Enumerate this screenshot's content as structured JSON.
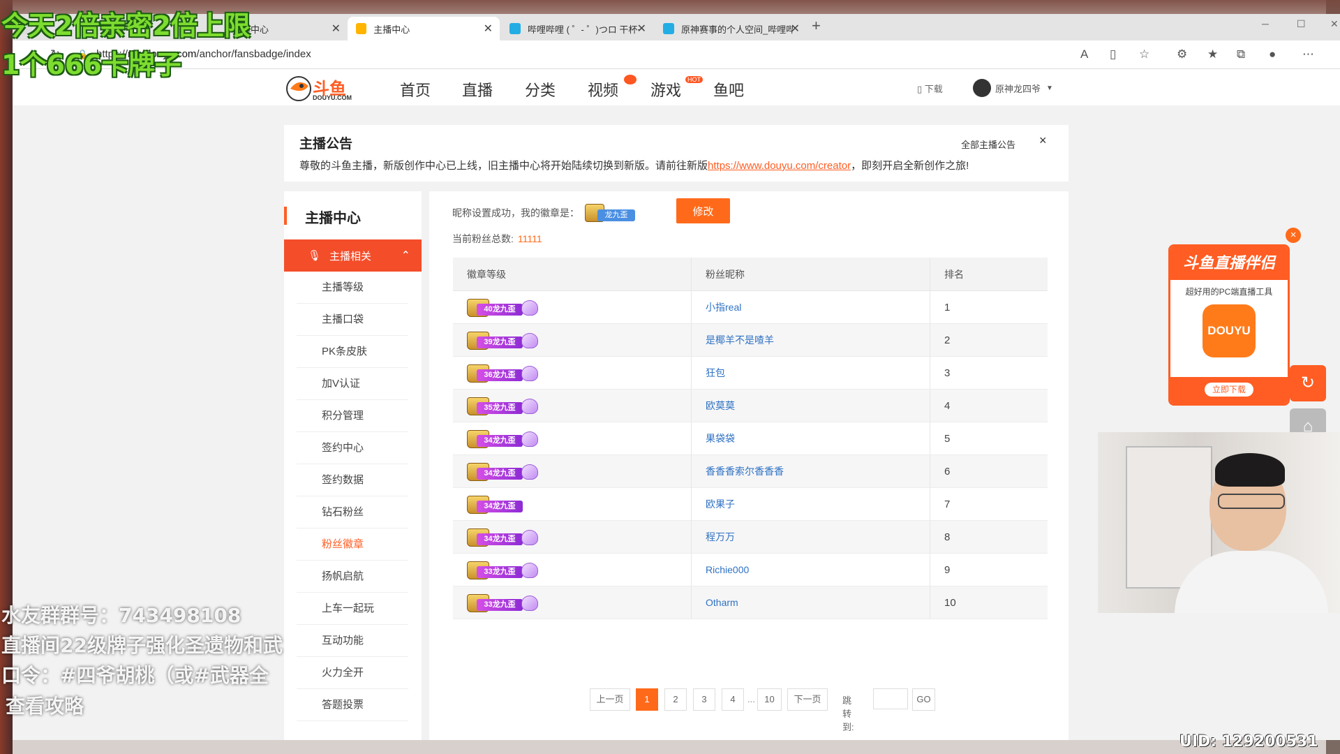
{
  "browser": {
    "tabs": [
      {
        "title": "作中心",
        "favicon_color": "#e8e8e8"
      },
      {
        "title": "主播中心",
        "favicon_color": "#ffb400"
      },
      {
        "title": "哔哩哔哩 ( ゜- ゜)つロ 干杯~-bilib",
        "favicon_color": "#23ade5"
      },
      {
        "title": "原神赛事的个人空间_哔哩哔哩_b",
        "favicon_color": "#23ade5"
      }
    ],
    "url_prefix": "https://",
    "url_host": "mp.douyu.com",
    "url_path": "/anchor/fansbadge/index"
  },
  "header": {
    "logo_text": "斗鱼",
    "logo_sub": "DOUYU.COM",
    "nav": [
      "首页",
      "直播",
      "分类",
      "视频",
      "游戏",
      "鱼吧"
    ],
    "hot_badge": "HOT",
    "download": "下载",
    "username": "原神龙四爷"
  },
  "announcement": {
    "title": "主播公告",
    "text_before": "尊敬的斗鱼主播，新版创作中心已上线，旧主播中心将开始陆续切换到新版。请前往新版",
    "link": "https://www.douyu.com/creator",
    "text_after": "，即刻开启全新创作之旅!",
    "all_link": "全部主播公告",
    "close": "×"
  },
  "sidebar": {
    "title": "主播中心",
    "group": "主播相关",
    "items": [
      "主播等级",
      "主播口袋",
      "PK条皮肤",
      "加V认证",
      "积分管理",
      "签约中心",
      "签约数据",
      "钻石粉丝",
      "粉丝徽章",
      "扬帆启航",
      "上车一起玩",
      "互动功能",
      "火力全开",
      "答题投票"
    ],
    "active_item": "粉丝徽章"
  },
  "main": {
    "nick_prefix": "昵称设置成功，我的徽章是：",
    "my_badge": "龙九歪",
    "modify_button": "修改",
    "fan_total_label": "当前粉丝总数:",
    "fan_total": "11111",
    "table": {
      "headers": [
        "徽章等级",
        "粉丝昵称",
        "排名"
      ],
      "rows": [
        {
          "level": "40",
          "badge": "龙九歪",
          "nick": "小指real",
          "rank": "1",
          "gem": true
        },
        {
          "level": "39",
          "badge": "龙九歪",
          "nick": "是椰羊不是喳羊",
          "rank": "2",
          "gem": true
        },
        {
          "level": "36",
          "badge": "龙九歪",
          "nick": "狂包",
          "rank": "3",
          "gem": true
        },
        {
          "level": "35",
          "badge": "龙九歪",
          "nick": "欧莫莫",
          "rank": "4",
          "gem": true
        },
        {
          "level": "34",
          "badge": "龙九歪",
          "nick": "果袋袋",
          "rank": "5",
          "gem": true
        },
        {
          "level": "34",
          "badge": "龙九歪",
          "nick": "香香香索尔香香香",
          "rank": "6",
          "gem": true
        },
        {
          "level": "34",
          "badge": "龙九歪",
          "nick": "欧果子",
          "rank": "7",
          "gem": false
        },
        {
          "level": "34",
          "badge": "龙九歪",
          "nick": "程万万",
          "rank": "8",
          "gem": true
        },
        {
          "level": "33",
          "badge": "龙九歪",
          "nick": "Richie000",
          "rank": "9",
          "gem": true
        },
        {
          "level": "33",
          "badge": "龙九歪",
          "nick": "Otharm",
          "rank": "10",
          "gem": true
        }
      ]
    },
    "pager": {
      "prev": "上一页",
      "pages": [
        "1",
        "2",
        "3",
        "4"
      ],
      "ellipsis": "...",
      "last": "10",
      "next": "下一页",
      "jump_label": "跳转到:",
      "go": "GO",
      "current": "1"
    }
  },
  "promo": {
    "title": "斗鱼直播伴侣",
    "subtitle": "超好用的PC端直播工具",
    "logo": "DOUYU",
    "button": "立即下载",
    "close": "×"
  },
  "overlays": {
    "line1": "今天2倍亲密2倍上限",
    "line2": "1个666卡牌子",
    "white1": "水友群群号：743498108",
    "white2": "直播间22级牌子强化圣遗物和武",
    "white3": "口令：#四爷胡桃（或#武器全",
    "white4": "查看攻略",
    "uid": "UID: 129200531"
  },
  "colors": {
    "accent": "#ff5d23",
    "link": "#2f72c4",
    "badge_purple": "#b23fe0"
  }
}
